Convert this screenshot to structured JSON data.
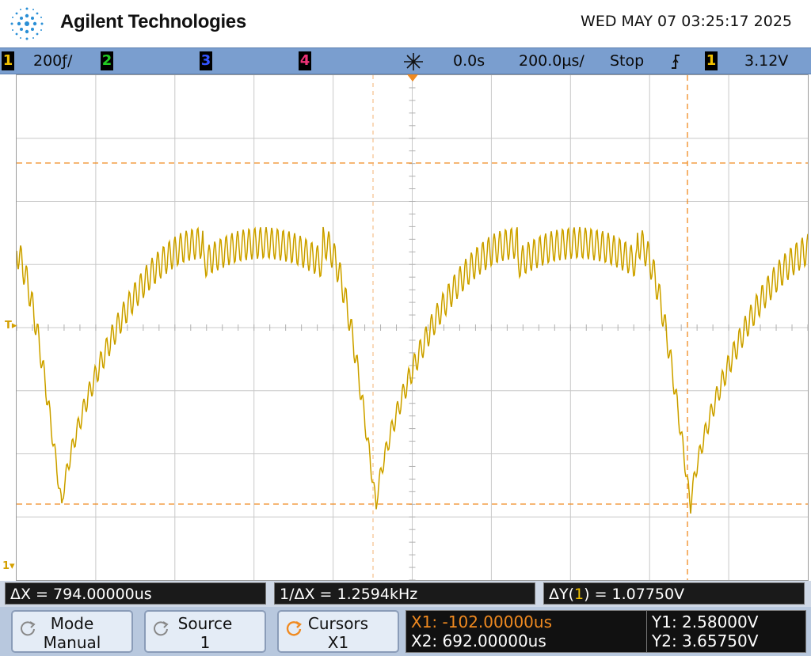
{
  "header": {
    "brand": "Agilent Technologies",
    "datetime": "WED MAY 07 03:25:17 2025"
  },
  "status_bar": {
    "ch1": {
      "num": "1",
      "scale": "200ƒ/",
      "color": "#f0c000"
    },
    "ch2": {
      "num": "2",
      "color": "#22cc22"
    },
    "ch3": {
      "num": "3",
      "color": "#3355ff"
    },
    "ch4": {
      "num": "4",
      "color": "#ee3377"
    },
    "trigger_delay": "0.0s",
    "timebase": "200.0µs/",
    "run_state": "Stop",
    "trigger_source": "1",
    "trigger_level": "3.12V"
  },
  "readouts": {
    "delta_x": "ΔX = 794.00000us",
    "inv_delta_x": "1/ΔX = 1.2594kHz",
    "delta_y_prefix": "ΔY(",
    "delta_y_ch": "1",
    "delta_y_suffix": ") = 1.07750V"
  },
  "softkeys": {
    "mode": {
      "label": "Mode",
      "value": "Manual"
    },
    "source": {
      "label": "Source",
      "value": "1"
    },
    "cursors": {
      "label": "Cursors",
      "value": "X1"
    }
  },
  "cursor_values": {
    "x1": "X1: -102.00000us",
    "x2": "X2: 692.00000us",
    "y1": "Y1: 2.58000V",
    "y2": "Y2: 3.65750V"
  },
  "markers": {
    "trigger": "T",
    "ground": "1"
  },
  "colors": {
    "trace": "#e8b800",
    "cursor": "#f08a20",
    "status_bg": "#7a9ecf",
    "accent_orange": "#f08a20"
  }
}
